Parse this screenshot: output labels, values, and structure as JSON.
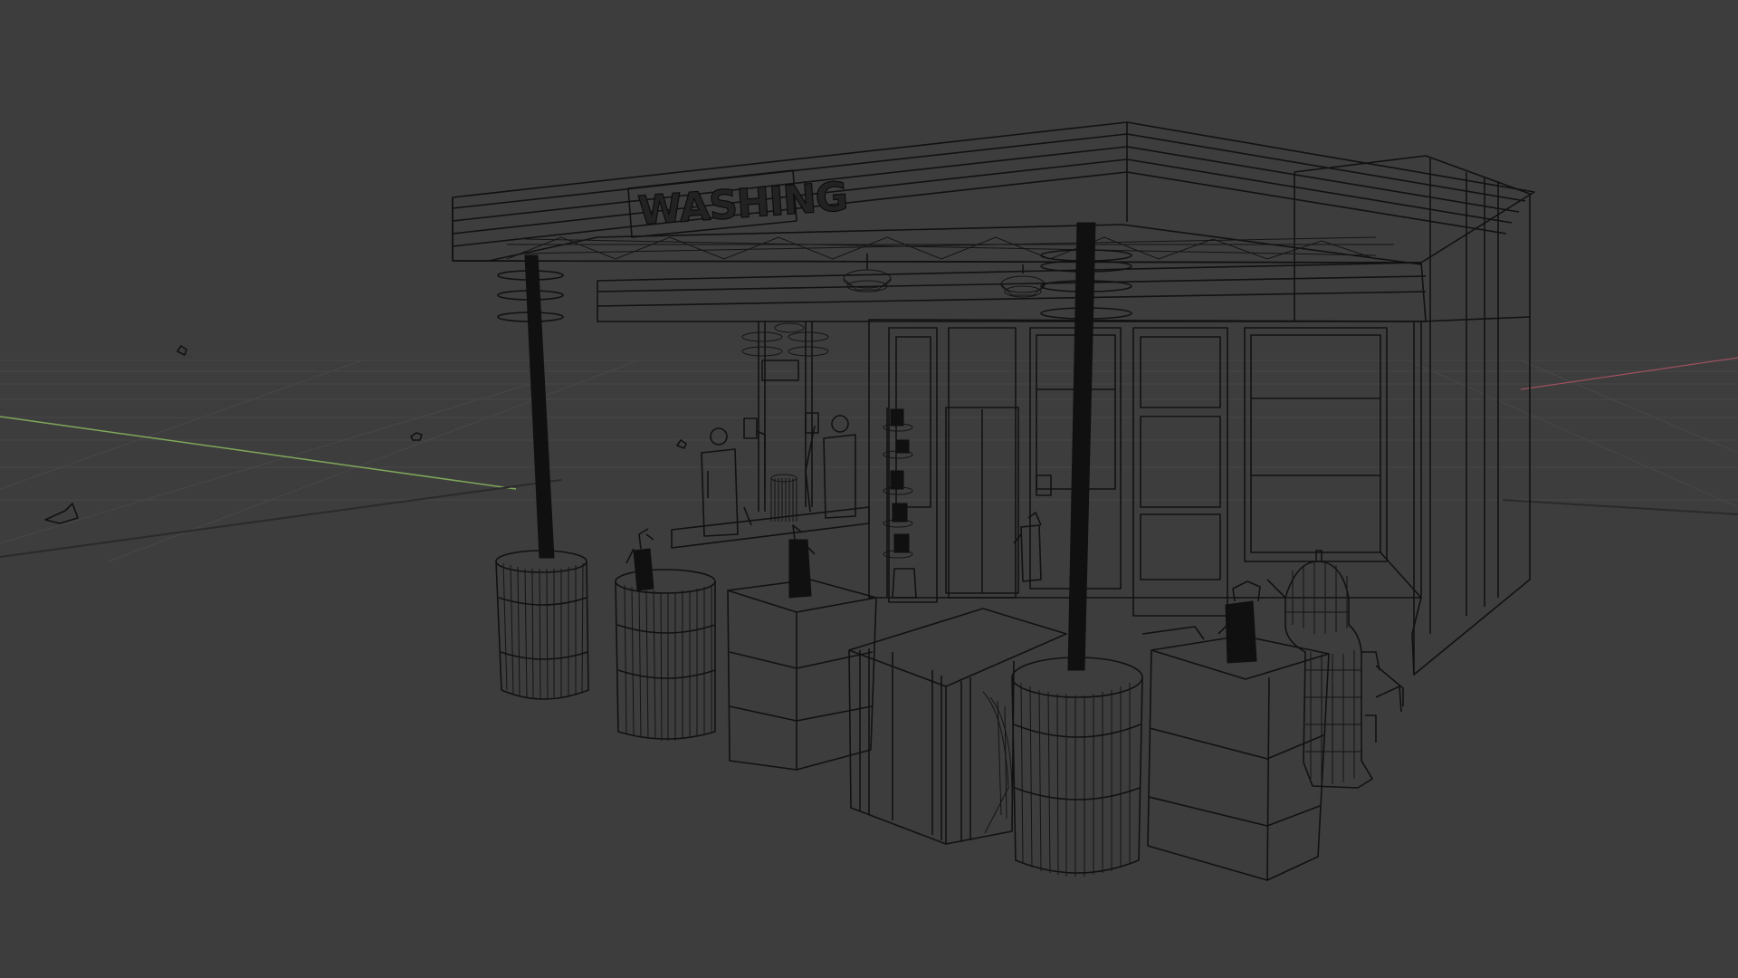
{
  "scene": {
    "sign_text": "WASHING",
    "background_color": "#3d3d3d",
    "wire_color": "#111111",
    "x_axis_color": "#7fa85a",
    "y_axis_color": "#a05060"
  }
}
